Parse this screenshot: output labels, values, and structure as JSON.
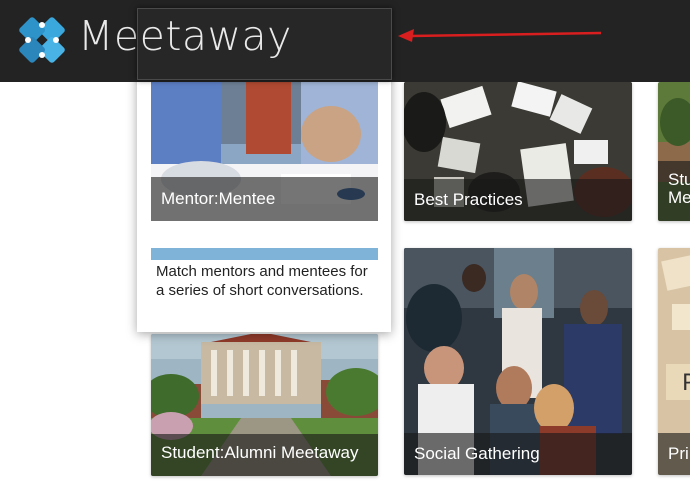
{
  "header": {
    "brand": "Meetaway",
    "logo_icon": "puzzle-logo-icon",
    "background": "#232323"
  },
  "annotation": {
    "arrow_color": "#d81e1e"
  },
  "tiles": [
    {
      "label": "Mentor:Mentee",
      "description": "Match mentors and mentees for a series of short conversations."
    },
    {
      "label": "Best Practices"
    },
    {
      "label": "Stu Me"
    },
    {
      "label": "Student:Alumni Meetaway"
    },
    {
      "label": "Social Gathering"
    },
    {
      "label": "Pri"
    }
  ]
}
